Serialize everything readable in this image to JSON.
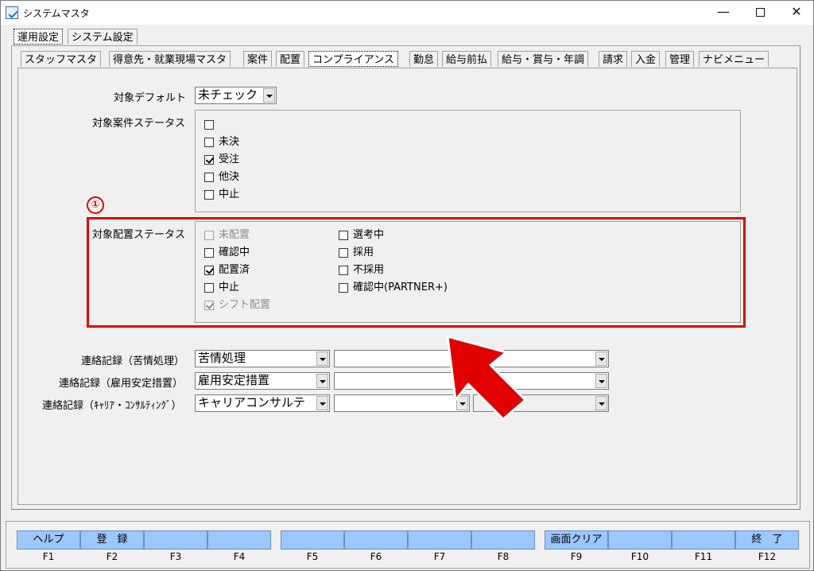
{
  "window": {
    "title": "システムマスタ",
    "minimize_glyph": "—",
    "close_glyph": "✕"
  },
  "top_tabs": [
    {
      "label": "運用設定",
      "active": true
    },
    {
      "label": "システム設定",
      "active": false
    }
  ],
  "sub_tabs": [
    {
      "label": "スタッフマスタ"
    },
    {
      "label": "得意先・就業現場マスタ"
    },
    {
      "label": "案件"
    },
    {
      "label": "配置"
    },
    {
      "label": "コンプライアンス",
      "active": true
    },
    {
      "label": "勤怠"
    },
    {
      "label": "給与前払"
    },
    {
      "label": "給与・賞与・年調"
    },
    {
      "label": "請求"
    },
    {
      "label": "入金"
    },
    {
      "label": "管理"
    },
    {
      "label": "ナビメニュー"
    }
  ],
  "form": {
    "default_label": "対象デフォルト",
    "default_value": "未チェック",
    "case_status_label": "対象案件ステータス",
    "case_status_options": [
      {
        "label": "",
        "checked": false
      },
      {
        "label": "未決",
        "checked": false
      },
      {
        "label": "受注",
        "checked": true
      },
      {
        "label": "他決",
        "checked": false
      },
      {
        "label": "中止",
        "checked": false
      }
    ],
    "placement_status_label": "対象配置ステータス",
    "placement_left": [
      {
        "label": "未配置",
        "checked": false,
        "disabled": true
      },
      {
        "label": "確認中",
        "checked": false,
        "disabled": false
      },
      {
        "label": "配置済",
        "checked": true,
        "disabled": false
      },
      {
        "label": "中止",
        "checked": false,
        "disabled": false
      },
      {
        "label": "シフト配置",
        "checked": true,
        "disabled": true
      }
    ],
    "placement_right": [
      {
        "label": "選考中",
        "checked": false
      },
      {
        "label": "採用",
        "checked": false
      },
      {
        "label": "不採用",
        "checked": false
      },
      {
        "label": "確認中(PARTNER+)",
        "checked": false
      }
    ],
    "contact_rows": [
      {
        "label": "連絡記録（苦情処理）",
        "value1": "苦情処理",
        "value2": "",
        "value3": ""
      },
      {
        "label": "連絡記録（雇用安定措置）",
        "value1": "雇用安定措置",
        "value2": "",
        "value3": ""
      },
      {
        "label": "連絡記録（ｷｬﾘｱ・ｺﾝｻﾙﾃｨﾝｸﾞ）",
        "value1": "キャリアコンサルテ",
        "value2": "",
        "value3": ""
      }
    ]
  },
  "annotation": {
    "marker": "①",
    "color": "#e00000"
  },
  "function_keys": [
    {
      "label": "ヘルプ",
      "key": "F1"
    },
    {
      "label": "登　録",
      "key": "F2"
    },
    {
      "label": "",
      "key": "F3"
    },
    {
      "label": "",
      "key": "F4"
    },
    {
      "label": "",
      "key": "F5"
    },
    {
      "label": "",
      "key": "F6"
    },
    {
      "label": "",
      "key": "F7"
    },
    {
      "label": "",
      "key": "F8"
    },
    {
      "label": "画面クリア",
      "key": "F9"
    },
    {
      "label": "",
      "key": "F10"
    },
    {
      "label": "",
      "key": "F11"
    },
    {
      "label": "終　了",
      "key": "F12"
    }
  ],
  "colors": {
    "function_button": "#9cc7ff",
    "highlight": "#e00000"
  }
}
